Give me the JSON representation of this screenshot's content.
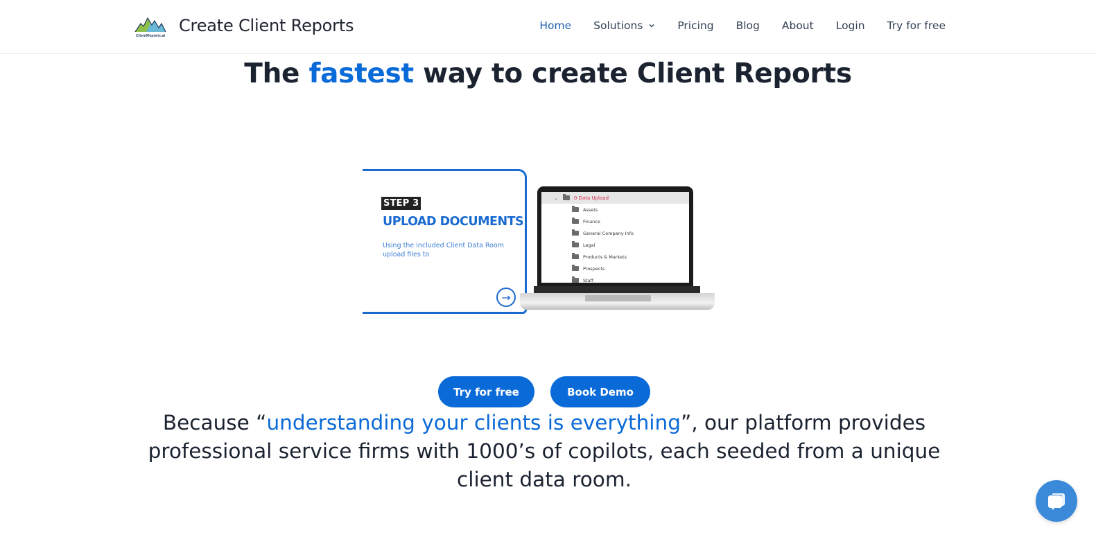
{
  "header": {
    "logo_alt": "ClientReports.ai",
    "brand_name": "Create Client Reports",
    "nav": [
      {
        "label": "Home",
        "active": true
      },
      {
        "label": "Solutions",
        "has_dropdown": true
      },
      {
        "label": "Pricing"
      },
      {
        "label": "Blog"
      },
      {
        "label": "About"
      },
      {
        "label": "Login"
      },
      {
        "label": "Try for free"
      }
    ]
  },
  "hero": {
    "headline_prefix": "The ",
    "headline_accent": "fastest",
    "headline_suffix": " way to create Client Reports",
    "image": {
      "step_badge": "STEP 3",
      "title": "UPLOAD DOCUMENTS",
      "description": "Using the included Client Data Room upload files to",
      "arrow_icon": "arrow-right-circle-icon",
      "laptop_screen": {
        "root_folder": "0 Data Upload",
        "folders": [
          "Assets",
          "Finance",
          "General Company Info",
          "Legal",
          "Products & Markets",
          "Prospects",
          "Staff"
        ]
      }
    },
    "buttons": {
      "try_free": "Try for free",
      "book_demo": "Book Demo"
    },
    "tagline": {
      "prefix": "Because “",
      "accent": "understanding your clients is everything",
      "suffix": "”, our platform provides professional service firms with 1000’s of copilots, each seeded from a unique client data room."
    }
  },
  "chat_widget": {
    "icon": "chat-bubbles-icon"
  },
  "colors": {
    "accent": "#0a6ad8",
    "nav_active": "#1e5fb0",
    "text_dark": "#1b2331",
    "chat_bg": "#3b8ad9",
    "folder_root": "#d9264f"
  }
}
